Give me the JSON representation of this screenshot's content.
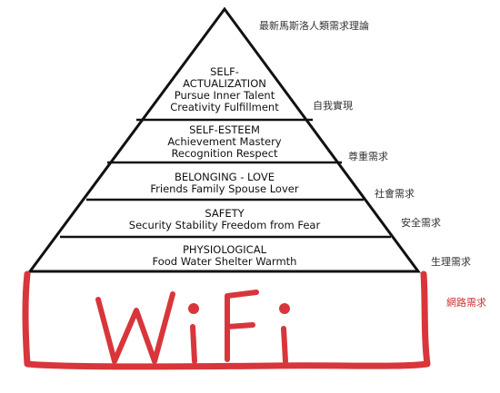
{
  "title_label": "最新馬斯洛人類需求理論",
  "tiers": [
    {
      "lines": [
        "SELF-",
        "ACTUALIZATION",
        "Pursue Inner Talent",
        "Creativity Fulfillment"
      ],
      "side_label": "自我實現"
    },
    {
      "lines": [
        "SELF-ESTEEM",
        "Achievement Mastery",
        "Recognition Respect"
      ],
      "side_label": "尊重需求"
    },
    {
      "lines": [
        "BELONGING - LOVE",
        "Friends Family Spouse Lover"
      ],
      "side_label": "社會需求"
    },
    {
      "lines": [
        "SAFETY",
        "Security Stability Freedom from Fear"
      ],
      "side_label": "安全需求"
    },
    {
      "lines": [
        "PHYSIOLOGICAL",
        "Food Water Shelter Warmth"
      ],
      "side_label": "生理需求"
    }
  ],
  "base": {
    "handwritten_text": "WiFi",
    "side_label": "網路需求",
    "color": "#d8363b"
  },
  "colors": {
    "pyramid_line": "#111111",
    "label_text": "#333333",
    "wifi_red": "#d8363b"
  }
}
